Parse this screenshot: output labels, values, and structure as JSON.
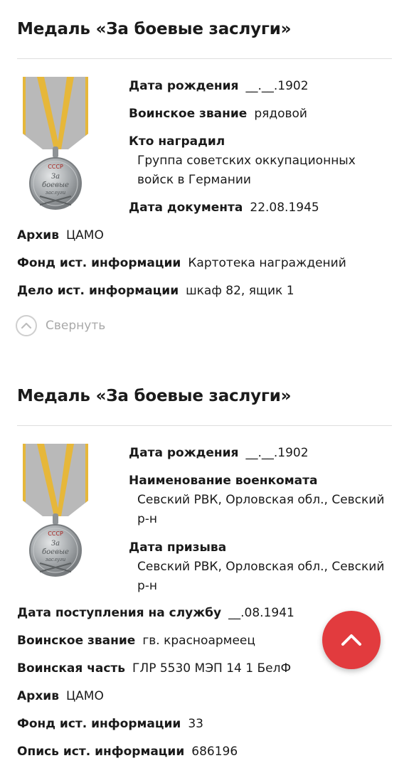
{
  "awards": [
    {
      "title": "Медаль «За боевые заслуги»",
      "birth_label": "Дата рождения",
      "birth_value": "__.__.1902",
      "rank_label": "Воинское звание",
      "rank_value": "рядовой",
      "awarded_by_label": "Кто наградил",
      "awarded_by_value": "Группа советских оккупационных войск в Германии",
      "doc_date_label": "Дата документа",
      "doc_date_value": "22.08.1945",
      "archive_label": "Архив",
      "archive_value": "ЦАМО",
      "fond_label": "Фонд ист. информации",
      "fond_value": "Картотека награждений",
      "case_label": "Дело ист. информации",
      "case_value": "шкаф 82, ящик 1",
      "collapse_label": "Свернуть",
      "medal_inscription": [
        "СССР",
        "ЗА",
        "БОЕВЫЕ",
        "ЗАСЛУГИ"
      ]
    },
    {
      "title": "Медаль «За боевые заслуги»",
      "birth_label": "Дата рождения",
      "birth_value": "__.__.1902",
      "office_label": "Наименование военкомата",
      "office_value": "Севский РВК, Орловская обл., Севский р-н",
      "draft_label": "Дата призыва",
      "draft_value": "Севский РВК, Орловская обл., Севский р-н",
      "service_label": "Дата поступления на службу",
      "service_value": "__.08.1941",
      "rank_label": "Воинское звание",
      "rank_value": "гв. красноармеец",
      "unit_label": "Воинская часть",
      "unit_value": "ГЛР 5530 МЭП 14 1 БелФ",
      "archive_label": "Архив",
      "archive_value": "ЦАМО",
      "fond_label": "Фонд ист. информации",
      "fond_value": "33",
      "opis_label": "Опись ист. информации",
      "opis_value": "686196",
      "medal_inscription": [
        "СССР",
        "ЗА",
        "БОЕВЫЕ",
        "ЗАСЛУГИ"
      ]
    }
  ],
  "colors": {
    "ribbon_grey": "#b9b9b9",
    "ribbon_stripe": "#e6b73a",
    "medal_silver": "#9fa3a6",
    "fab_red": "#e23b3e",
    "divider": "#dedede",
    "muted_text": "#a9a9a9"
  },
  "icons": {
    "medal": "medal-za-boevye-zaslugi-icon",
    "collapse": "chevron-up-circle-icon",
    "fab": "chevron-up-icon"
  }
}
